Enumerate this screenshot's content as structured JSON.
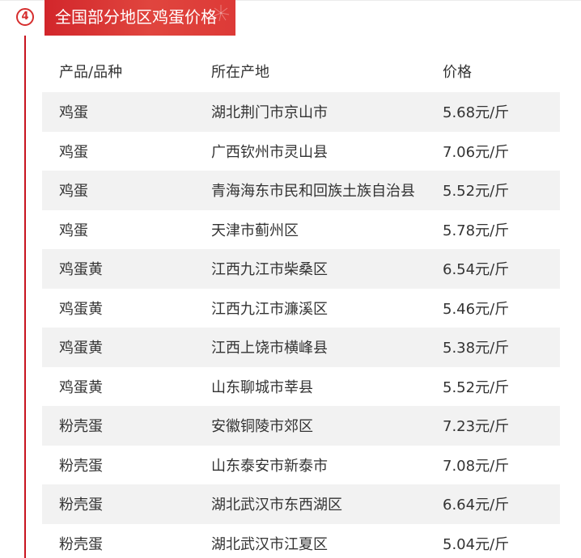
{
  "section": {
    "step_number": "4",
    "title": "全国部分地区鸡蛋价格"
  },
  "colors": {
    "accent": "#d62e2e",
    "banner": "#d2262b",
    "row_shade": "#f2f2f2",
    "text": "#333333"
  },
  "table": {
    "headers": [
      "产品/品种",
      "所在产地",
      "价格"
    ],
    "rows": [
      {
        "product": "鸡蛋",
        "origin": "湖北荆门市京山市",
        "price": "5.68元/斤"
      },
      {
        "product": "鸡蛋",
        "origin": "广西钦州市灵山县",
        "price": "7.06元/斤"
      },
      {
        "product": "鸡蛋",
        "origin": "青海海东市民和回族土族自治县",
        "price": "5.52元/斤"
      },
      {
        "product": "鸡蛋",
        "origin": "天津市蓟州区",
        "price": "5.78元/斤"
      },
      {
        "product": "鸡蛋黄",
        "origin": "江西九江市柴桑区",
        "price": "6.54元/斤"
      },
      {
        "product": "鸡蛋黄",
        "origin": "江西九江市濂溪区",
        "price": "5.46元/斤"
      },
      {
        "product": "鸡蛋黄",
        "origin": "江西上饶市横峰县",
        "price": "5.38元/斤"
      },
      {
        "product": "鸡蛋黄",
        "origin": "山东聊城市莘县",
        "price": "5.52元/斤"
      },
      {
        "product": "粉壳蛋",
        "origin": "安徽铜陵市郊区",
        "price": "7.23元/斤"
      },
      {
        "product": "粉壳蛋",
        "origin": "山东泰安市新泰市",
        "price": "7.08元/斤"
      },
      {
        "product": "粉壳蛋",
        "origin": "湖北武汉市东西湖区",
        "price": "6.64元/斤"
      },
      {
        "product": "粉壳蛋",
        "origin": "湖北武汉市江夏区",
        "price": "5.04元/斤"
      }
    ]
  }
}
